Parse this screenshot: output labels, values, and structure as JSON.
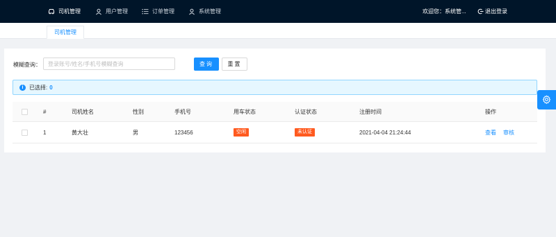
{
  "topbar": {
    "nav": [
      {
        "label": "司机管理",
        "icon": "car-icon"
      },
      {
        "label": "用户管理",
        "icon": "user-icon"
      },
      {
        "label": "订单管理",
        "icon": "list-icon"
      },
      {
        "label": "系统管理",
        "icon": "user-icon"
      }
    ],
    "welcome": "欢迎您：系统管...",
    "logout": "退出登录"
  },
  "tabs": [
    {
      "label": "司机管理"
    }
  ],
  "search": {
    "label": "模糊查询：",
    "placeholder": "登录账号/姓名/手机号模糊查询",
    "value": "",
    "query_button": "查询",
    "reset_button": "重置"
  },
  "selection": {
    "label": "已选择:",
    "count": "0"
  },
  "table": {
    "headers": {
      "index": "#",
      "name": "司机姓名",
      "gender": "性别",
      "phone": "手机号",
      "car_status": "用车状态",
      "auth_status": "认证状态",
      "register_time": "注册时间",
      "actions": "操作"
    },
    "rows": [
      {
        "index": "1",
        "name": "黄大壮",
        "gender": "男",
        "phone": "123456",
        "car_status": "空闲",
        "auth_status": "未认证",
        "register_time": "2021-04-04 21:24:44",
        "view": "查看",
        "audit": "审核"
      }
    ]
  },
  "colors": {
    "topbar": "#001529",
    "primary": "#1890ff",
    "tag": "#ff5a1f",
    "alert_bg": "#e6f7ff"
  }
}
